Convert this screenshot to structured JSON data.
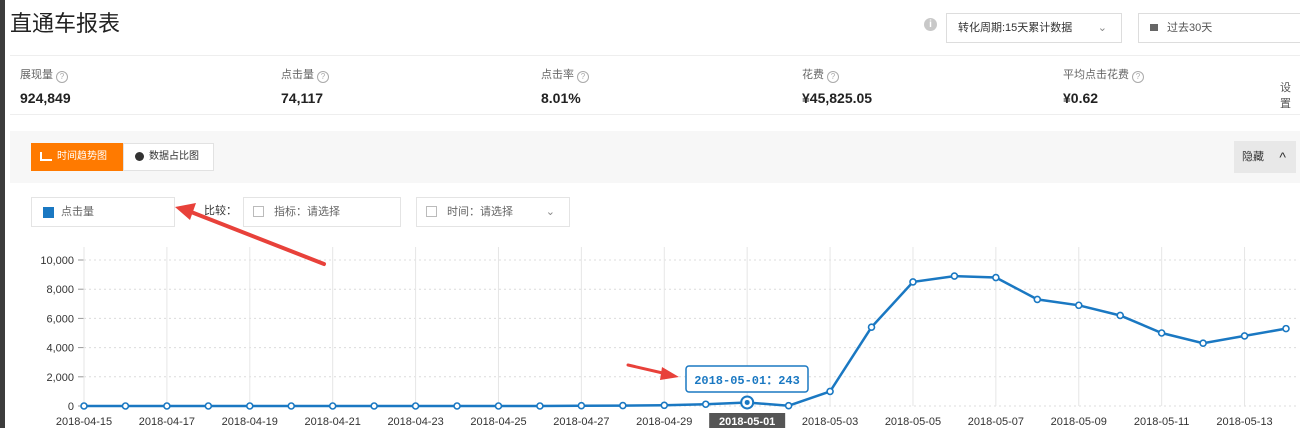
{
  "page": {
    "title": "直通车报表"
  },
  "toolbar": {
    "info_icon": "info-icon",
    "conversion_cycle": "转化周期:15天累计数据",
    "date_range": "过去30天"
  },
  "metrics": [
    {
      "label": "展现量",
      "value": "924,849"
    },
    {
      "label": "点击量",
      "value": "74,117"
    },
    {
      "label": "点击率",
      "value": "8.01%"
    },
    {
      "label": "花费",
      "value": "¥45,825.05"
    },
    {
      "label": "平均点击花费",
      "value": "¥0.62"
    }
  ],
  "settings_label": "设置",
  "tabs": {
    "trend": "时间趋势图",
    "share": "数据占比图"
  },
  "hide_button": "隐藏",
  "metric_select": "点击量",
  "compare": {
    "label": "比较：",
    "metric_placeholder": "指标：请选择",
    "time_placeholder": "时间：请选择"
  },
  "colors": {
    "accent": "#ff7a00",
    "series": "#1a78c2",
    "annotation_arrow": "#e8413a"
  },
  "chart_data": {
    "type": "line",
    "title": "",
    "xlabel": "",
    "ylabel": "",
    "ylim": [
      0,
      10000
    ],
    "yticks": [
      "0",
      "2,000",
      "4,000",
      "6,000",
      "8,000",
      "10,000"
    ],
    "x": [
      "2018-04-15",
      "2018-04-16",
      "2018-04-17",
      "2018-04-18",
      "2018-04-19",
      "2018-04-20",
      "2018-04-21",
      "2018-04-22",
      "2018-04-23",
      "2018-04-24",
      "2018-04-25",
      "2018-04-26",
      "2018-04-27",
      "2018-04-28",
      "2018-04-29",
      "2018-04-30",
      "2018-05-01",
      "2018-05-02",
      "2018-05-03",
      "2018-05-04",
      "2018-05-05",
      "2018-05-06",
      "2018-05-07",
      "2018-05-08",
      "2018-05-09",
      "2018-05-10",
      "2018-05-11",
      "2018-05-12",
      "2018-05-13",
      "2018-05-14"
    ],
    "xtick_labels": [
      "2018-04-15",
      "2018-04-17",
      "2018-04-19",
      "2018-04-21",
      "2018-04-23",
      "2018-04-25",
      "2018-04-27",
      "2018-04-29",
      "2018-05-01",
      "2018-05-03",
      "2018-05-05",
      "2018-05-07",
      "2018-05-09",
      "2018-05-11",
      "2018-05-13"
    ],
    "series": [
      {
        "values": [
          0,
          0,
          0,
          0,
          0,
          0,
          0,
          0,
          0,
          0,
          0,
          0,
          20,
          30,
          50,
          120,
          243,
          20,
          1000,
          5400,
          8500,
          8900,
          8800,
          7300,
          6900,
          6200,
          5000,
          4300,
          4800,
          5300
        ]
      }
    ],
    "highlight": {
      "x": "2018-05-01",
      "text": "2018-05-01：243"
    },
    "grid": true,
    "legend": "none"
  }
}
